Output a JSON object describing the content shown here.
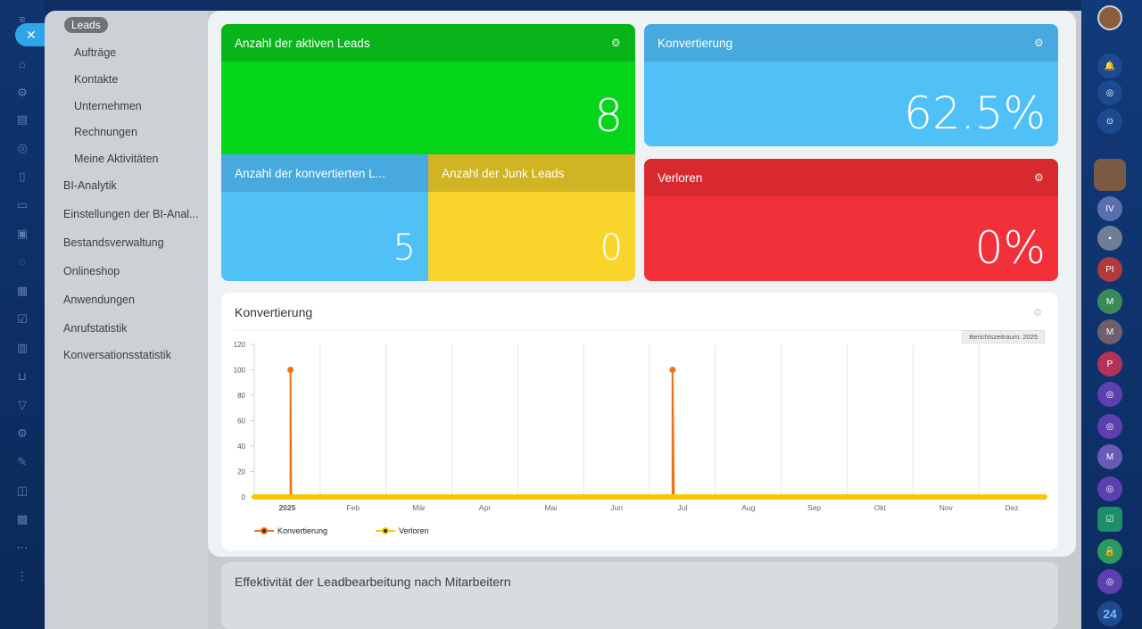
{
  "sidebar": {
    "pill": "Leads",
    "items": [
      "Aufträge",
      "Kontakte",
      "Unternehmen",
      "Rechnungen",
      "Meine Aktivitäten"
    ],
    "main_items": [
      "BI-Analytik",
      "Einstellungen der BI-Anal...",
      "Bestandsverwaltung",
      "Onlineshop",
      "Anwendungen",
      "Anrufstatistik",
      "Konversationsstatistik"
    ]
  },
  "tiles": {
    "active": {
      "title": "Anzahl der aktiven Leads",
      "value": "8",
      "color": "#06d61a",
      "head_color": "#08b41a"
    },
    "conversion": {
      "title": "Konvertierung",
      "value": "62.5%",
      "color": "#50c1f6",
      "head_color": "#47a9dd"
    },
    "converted": {
      "title": "Anzahl der konvertierten L...",
      "value": "5",
      "color": "#50c1f6",
      "head_color": "#47a9dd"
    },
    "junk": {
      "title": "Anzahl der Junk Leads",
      "value": "0",
      "color": "#f9d52b",
      "head_color": "#d1b423"
    },
    "lost": {
      "title": "Verloren",
      "value": "0%",
      "color": "#f1303a",
      "head_color": "#d8292f"
    }
  },
  "chart_card": {
    "title": "Konvertierung",
    "badge": "Berichtszeitraum: 2025"
  },
  "bg_card": {
    "title": "Effektivität der Leadbearbeitung nach Mitarbeitern"
  },
  "right_rail": {
    "logo": "24"
  },
  "chart_data": {
    "type": "line",
    "categories": [
      "2025",
      "Feb",
      "Mär",
      "Apr",
      "Mai",
      "Jun",
      "Jul",
      "Aug",
      "Sep",
      "Okt",
      "Nov",
      "Dez"
    ],
    "yticks": [
      0,
      20,
      40,
      60,
      80,
      100,
      120
    ],
    "ylim": [
      0,
      120
    ],
    "series": [
      {
        "name": "Konvertierung",
        "color": "#f07214",
        "points": [
          [
            0.05,
            0
          ],
          [
            0.05,
            100
          ],
          [
            0.06,
            0
          ],
          [
            5.85,
            0
          ],
          [
            5.85,
            100
          ],
          [
            5.87,
            0
          ],
          [
            11.5,
            0
          ]
        ]
      },
      {
        "name": "Verloren",
        "color": "#f5c70a",
        "points": [
          [
            -0.5,
            0
          ],
          [
            11.5,
            0
          ]
        ]
      }
    ],
    "grid": "vertical"
  }
}
